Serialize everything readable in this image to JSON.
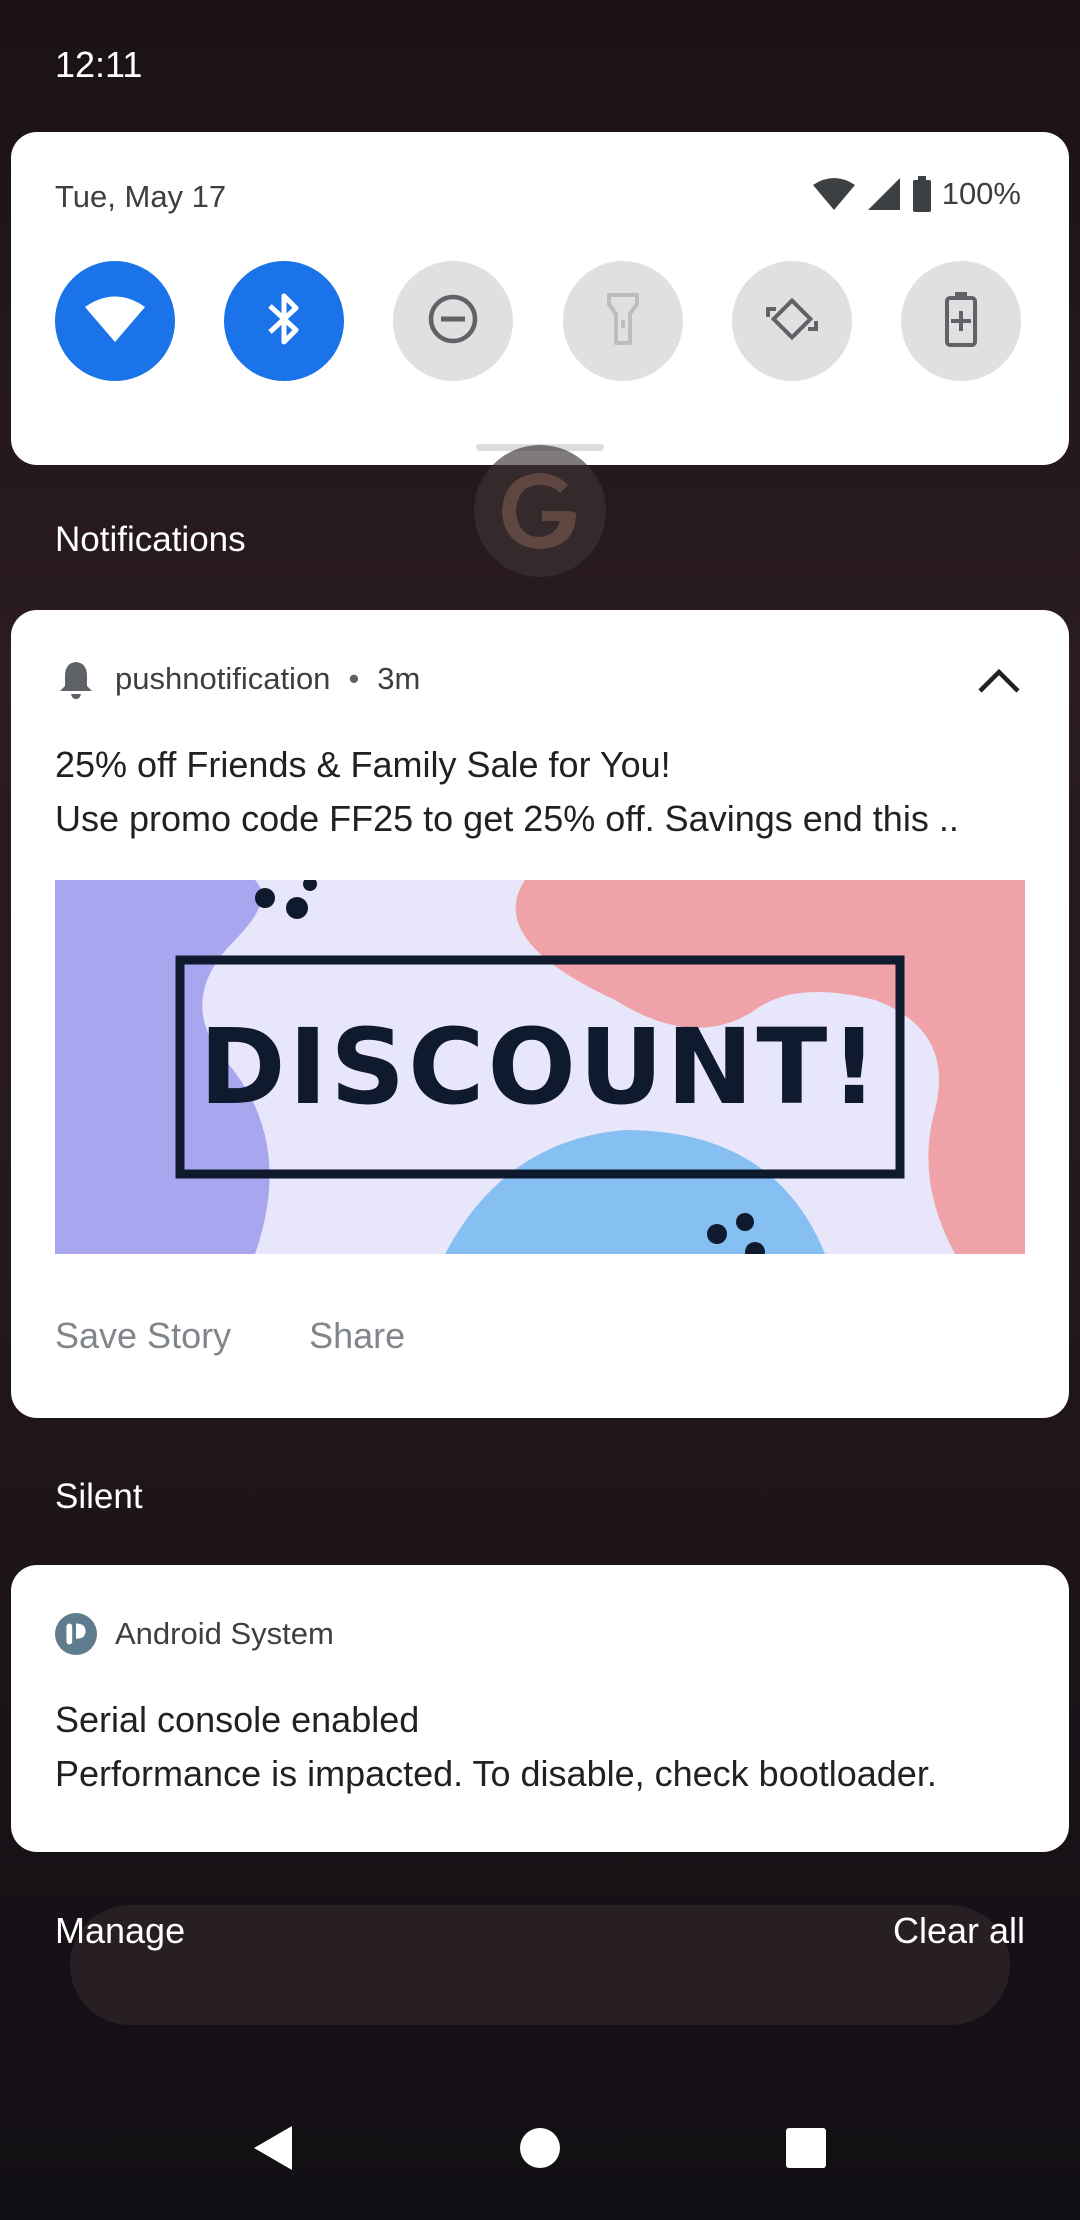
{
  "status_bar": {
    "time": "12:11"
  },
  "quick_settings": {
    "date": "Tue, May 17",
    "battery": "100%",
    "tiles": [
      {
        "name": "wifi",
        "state": "on",
        "icon": "wifi-icon"
      },
      {
        "name": "bluetooth",
        "state": "on",
        "icon": "bluetooth-icon"
      },
      {
        "name": "do-not-disturb",
        "state": "off",
        "icon": "dnd-icon"
      },
      {
        "name": "flashlight",
        "state": "off",
        "icon": "flashlight-icon"
      },
      {
        "name": "auto-rotate",
        "state": "off",
        "icon": "rotate-icon"
      },
      {
        "name": "battery-saver",
        "state": "off",
        "icon": "battery-saver-icon"
      }
    ],
    "colors": {
      "active": "#1a73e8",
      "inactive": "#e0e0e0"
    }
  },
  "sections": {
    "notifications": "Notifications",
    "silent": "Silent"
  },
  "push_notification": {
    "app": "pushnotification",
    "time": "3m",
    "title": "25% off Friends & Family Sale for You!",
    "body": "Use promo code FF25 to get 25% off. Savings end this ..",
    "image_text": "DISCOUNT!",
    "actions": [
      "Save Story",
      "Share"
    ]
  },
  "system_notification": {
    "app": "Android System",
    "title": "Serial console enabled",
    "body": "Performance is impacted. To disable, check bootloader."
  },
  "footer": {
    "manage": "Manage",
    "clear_all": "Clear all"
  }
}
